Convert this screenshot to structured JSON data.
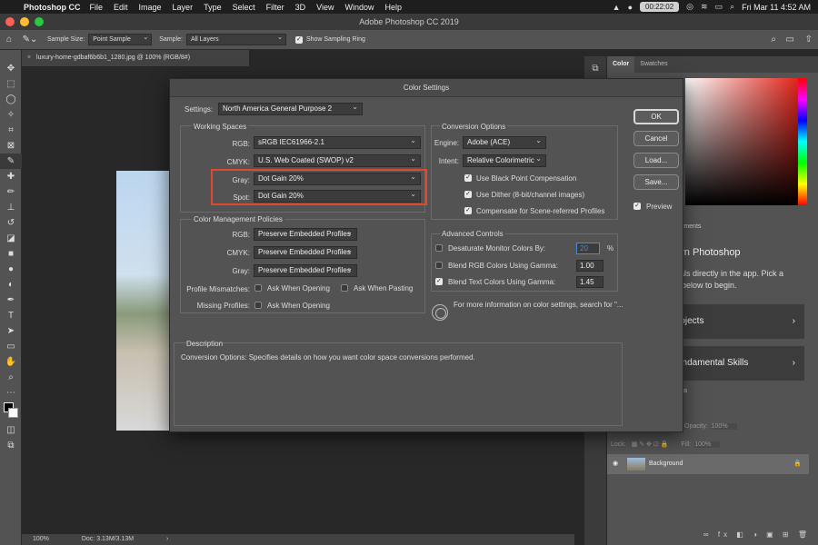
{
  "menubar": {
    "app_name": "Photoshop CC",
    "items": [
      "File",
      "Edit",
      "Image",
      "Layer",
      "Type",
      "Select",
      "Filter",
      "3D",
      "View",
      "Window",
      "Help"
    ],
    "timer": "00:22:02",
    "datetime": "Fri Mar 11  4:52 AM"
  },
  "window": {
    "title": "Adobe Photoshop CC 2019"
  },
  "options": {
    "sample_size_label": "Sample Size:",
    "sample_size_value": "Point Sample",
    "sample_label": "Sample:",
    "sample_value": "All Layers",
    "show_ring_label": "Show Sampling Ring",
    "show_ring_checked": true
  },
  "document": {
    "tab_title": "luxury-home-gdbaf6b6b1_1280.jpg @ 100% (RGB/8#)",
    "zoom": "100%",
    "doc_info": "Doc: 3.13M/3.13M"
  },
  "panels": {
    "color_tab": "Color",
    "swatches_tab": "Swatches",
    "adjustments_tab": "ustments",
    "learn_heading": "arn Photoshop",
    "learn_text_1": "rials directly in the app. Pick a",
    "learn_text_2": "c below to begin.",
    "learn_card_1": "rojects",
    "learn_card_2": "undamental Skills",
    "paths_tab": "aths",
    "opacity_label": "Opacity:",
    "opacity_value": "100%",
    "lock_label": "Lock:",
    "fill_label": "Fill:",
    "fill_value": "100%",
    "layer_name": "Background"
  },
  "dialog": {
    "title": "Color Settings",
    "settings_label": "Settings:",
    "settings_value": "North America General Purpose 2",
    "working_spaces": {
      "title": "Working Spaces",
      "rgb_label": "RGB:",
      "rgb_value": "sRGB IEC61966-2.1",
      "cmyk_label": "CMYK:",
      "cmyk_value": "U.S. Web Coated (SWOP) v2",
      "gray_label": "Gray:",
      "gray_value": "Dot Gain 20%",
      "spot_label": "Spot:",
      "spot_value": "Dot Gain 20%"
    },
    "policies": {
      "title": "Color Management Policies",
      "rgb_label": "RGB:",
      "rgb_value": "Preserve Embedded Profiles",
      "cmyk_label": "CMYK:",
      "cmyk_value": "Preserve Embedded Profiles",
      "gray_label": "Gray:",
      "gray_value": "Preserve Embedded Profiles",
      "mismatches_label": "Profile Mismatches:",
      "ask_opening": "Ask When Opening",
      "ask_pasting": "Ask When Pasting",
      "missing_label": "Missing Profiles:",
      "ask_opening_2": "Ask When Opening"
    },
    "conversion": {
      "title": "Conversion Options",
      "engine_label": "Engine:",
      "engine_value": "Adobe (ACE)",
      "intent_label": "Intent:",
      "intent_value": "Relative Colorimetric",
      "bpc": "Use Black Point Compensation",
      "dither": "Use Dither (8-bit/channel images)",
      "compensate": "Compensate for Scene-referred Profiles"
    },
    "advanced": {
      "title": "Advanced Controls",
      "desaturate": "Desaturate Monitor Colors By:",
      "desaturate_value": "20",
      "desaturate_unit": "%",
      "blend_rgb": "Blend RGB Colors Using Gamma:",
      "blend_rgb_value": "1.00",
      "blend_text": "Blend Text Colors Using Gamma:",
      "blend_text_value": "1.45",
      "info_text": "For more information on color settings, search for \"..."
    },
    "description": {
      "title": "Description",
      "text": "Conversion Options:  Specifies details on how you want color space conversions performed."
    },
    "buttons": {
      "ok": "OK",
      "cancel": "Cancel",
      "load": "Load...",
      "save": "Save...",
      "preview": "Preview"
    }
  },
  "colors": {
    "highlight": "#e0492b",
    "focus": "#4c8bd9"
  }
}
